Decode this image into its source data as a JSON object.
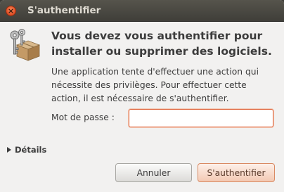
{
  "window": {
    "title": "S'authentifier"
  },
  "dialog": {
    "heading_line1": "Vous devez vous authentifier pour",
    "heading_line2": "installer ou supprimer des logiciels.",
    "description_line1": "Une application tente d'effectuer une action qui",
    "description_line2": "nécessite des privilèges. Pour effectuer cette",
    "description_line3": "action, il est nécessaire de s'authentifier.",
    "password_label": "Mot de passe :",
    "password_value": "",
    "details_label": "Détails",
    "cancel_label": "Annuler",
    "authenticate_label": "S'authentifier"
  },
  "icons": {
    "close": "close-icon",
    "keys": "keys-package-icon",
    "expander": "triangle-right-icon"
  },
  "colors": {
    "titlebar": "#3f3e39",
    "close_button": "#e4532a",
    "dialog_bg": "#f2f1f0",
    "focus_border": "#e0663d",
    "primary_button": "#f3c9b3"
  }
}
